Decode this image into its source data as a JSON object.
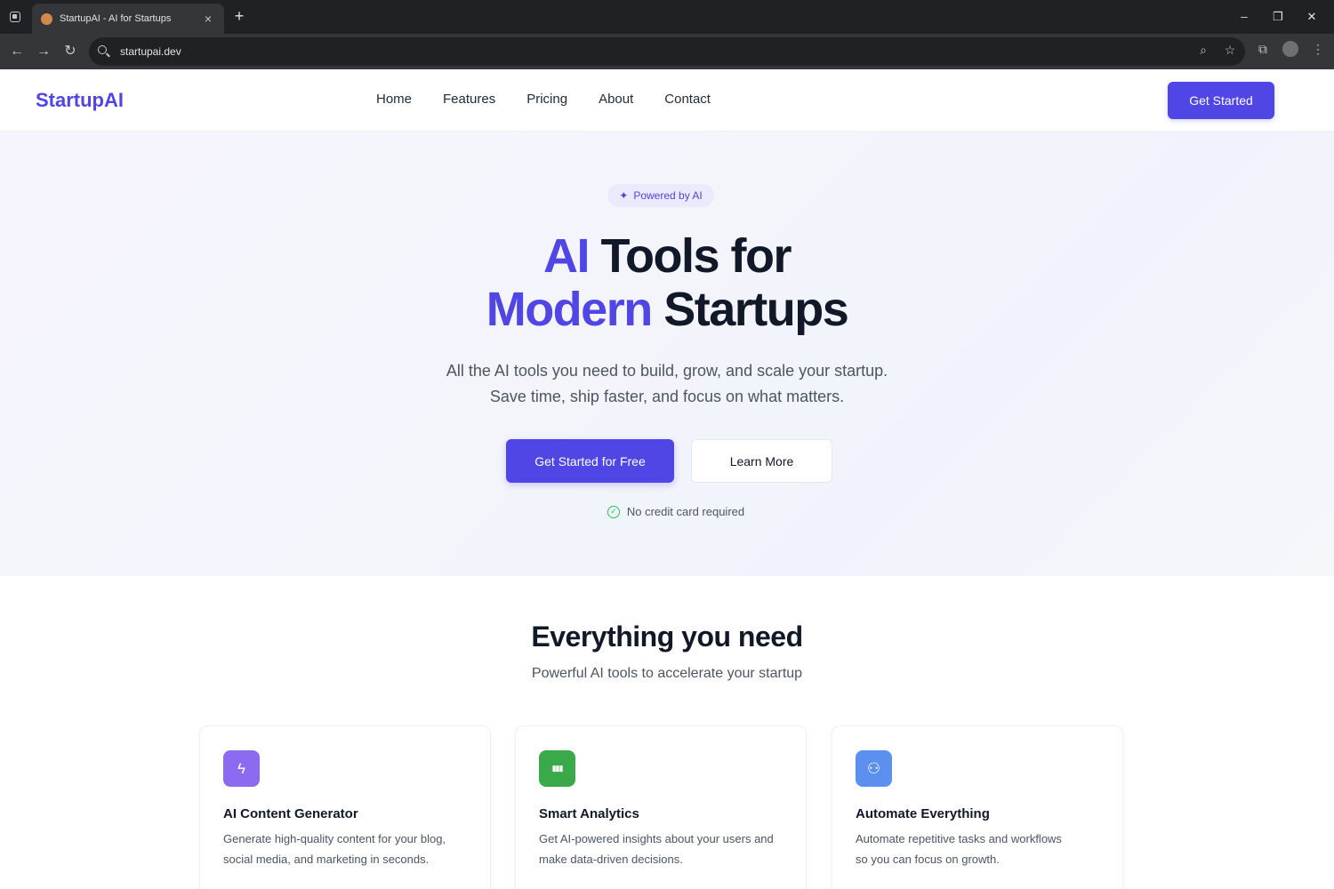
{
  "browser": {
    "tab_title": "StartupAI - AI for Startups",
    "tab_close": "×",
    "new_tab": "+",
    "url": "startupai.dev",
    "back": "←",
    "forward": "→",
    "reload": "↻",
    "minimize": "–",
    "restore": "❐",
    "close": "✕",
    "zoom": "⌕",
    "bookmark": "☆",
    "extensions": "⧉",
    "menu": "⋮"
  },
  "header": {
    "logo": "StartupAI",
    "nav": [
      {
        "label": "Home"
      },
      {
        "label": "Features"
      },
      {
        "label": "Pricing"
      },
      {
        "label": "About"
      },
      {
        "label": "Contact"
      }
    ],
    "cta": "Get Started"
  },
  "hero": {
    "badge": "Powered by AI",
    "badge_icon": "✦",
    "title_accent_1": "AI",
    "title_rest_1": " Tools for",
    "title_accent_2": "Modern",
    "title_rest_2": " Startups",
    "subtitle_line1": "All the AI tools you need to build, grow, and scale your startup.",
    "subtitle_line2": "Save time, ship faster, and focus on what matters.",
    "primary_button": "Get Started for Free",
    "secondary_button": "Learn More",
    "note": "No credit card required",
    "note_icon": "✓"
  },
  "features": {
    "title": "Everything you need",
    "subtitle": "Powerful AI tools to accelerate your startup",
    "cards": [
      {
        "title": "AI Content Generator",
        "desc_line1": "Generate high-quality content for your blog,",
        "desc_line2": "social media, and marketing in seconds.",
        "icon": "ϟ",
        "color": "#8b6cf0"
      },
      {
        "title": "Smart Analytics",
        "desc_line1": "Get AI-powered insights about your users and",
        "desc_line2": "make data-driven decisions.",
        "icon": "▮▮▮",
        "color": "#3aa94a"
      },
      {
        "title": "Automate Everything",
        "desc_line1": "Automate repetitive tasks and workflows",
        "desc_line2": "so you can focus on growth.",
        "icon": "⚇",
        "color": "#5b8ff0"
      }
    ]
  },
  "colors": {
    "accent": "#4f46e5",
    "text_dark": "#111827",
    "text_muted": "#4b5563",
    "success": "#22c55e"
  }
}
